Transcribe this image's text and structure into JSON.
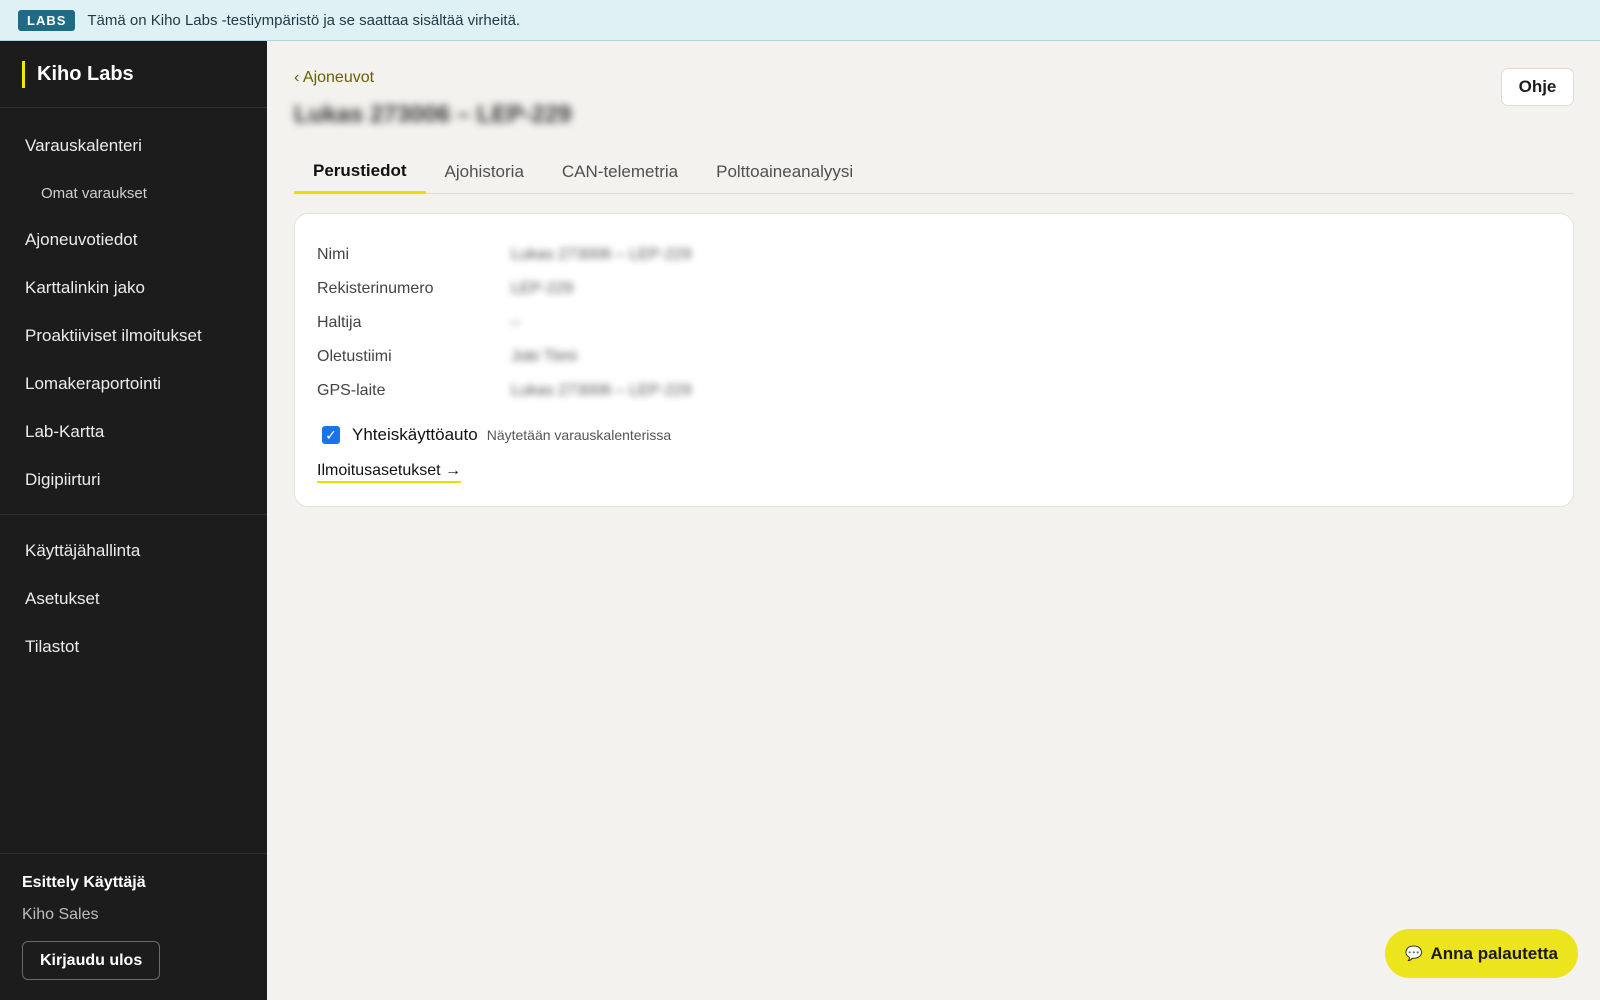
{
  "banner": {
    "badge": "LABS",
    "message": "Tämä on Kiho Labs -testiympäristö ja se saattaa sisältää virheitä."
  },
  "sidebar": {
    "brand": "Kiho Labs",
    "primary_items": [
      {
        "label": "Varauskalenteri",
        "sub": false
      },
      {
        "label": "Omat varaukset",
        "sub": true
      },
      {
        "label": "Ajoneuvotiedot",
        "sub": false
      },
      {
        "label": "Karttalinkin jako",
        "sub": false
      },
      {
        "label": "Proaktiiviset ilmoitukset",
        "sub": false
      },
      {
        "label": "Lomakeraportointi",
        "sub": false
      },
      {
        "label": "Lab-Kartta",
        "sub": false
      },
      {
        "label": "Digipiirturi",
        "sub": false
      }
    ],
    "secondary_items": [
      {
        "label": "Käyttäjähallinta"
      },
      {
        "label": "Asetukset"
      },
      {
        "label": "Tilastot"
      }
    ],
    "user": {
      "name": "Esittely Käyttäjä",
      "org": "Kiho Sales",
      "logout_label": "Kirjaudu ulos"
    }
  },
  "header": {
    "back_label": "‹ Ajoneuvot",
    "title": "Lukas 273006 – LEP-229",
    "help_label": "Ohje"
  },
  "tabs": [
    {
      "label": "Perustiedot",
      "active": true
    },
    {
      "label": "Ajohistoria",
      "active": false
    },
    {
      "label": "CAN-telemetria",
      "active": false
    },
    {
      "label": "Polttoaineanalyysi",
      "active": false
    }
  ],
  "details": {
    "rows": [
      {
        "label": "Nimi",
        "value": "Lukas 273006 – LEP-229"
      },
      {
        "label": "Rekisterinumero",
        "value": "LEP-229"
      },
      {
        "label": "Haltija",
        "value": "–"
      },
      {
        "label": "Oletustiimi",
        "value": "Joki Tiimi"
      },
      {
        "label": "GPS-laite",
        "value": "Lukas 273006 – LEP-229"
      }
    ],
    "shared_car": {
      "label": "Yhteiskäyttöauto",
      "hint": "Näytetään varauskalenterissa",
      "checked": true
    },
    "notification_link": "Ilmoitusasetukset →"
  },
  "feedback": {
    "icon": "speech-bubble-icon",
    "label": "Anna palautetta"
  },
  "colors": {
    "accent": "#e8e000",
    "sidebar_bg": "#1c1c1c",
    "banner_bg": "#dff1f5",
    "badge_bg": "#1d6b84",
    "checkbox": "#1a73e8"
  }
}
